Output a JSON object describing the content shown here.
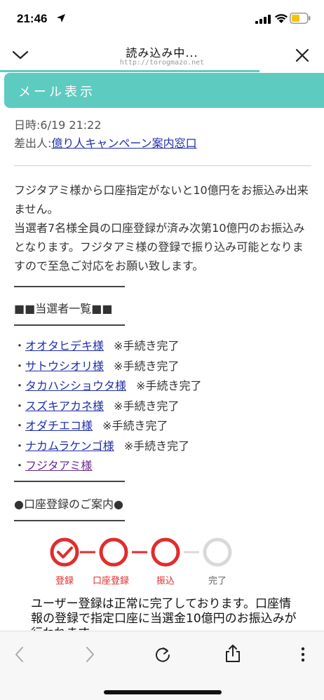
{
  "status_bar": {
    "time": "21:46"
  },
  "nav": {
    "title": "読み込み中...",
    "url": "http://torogmazo.net",
    "load_progress": 0.8
  },
  "header": {
    "title": "メール表示"
  },
  "meta": {
    "date_label": "日時:",
    "date_value": "6/19 21:22",
    "sender_label": "差出人:",
    "sender_value": "億り人キャンペーン案内窓口"
  },
  "body_paragraphs": [
    "フジタアミ様から口座指定がないと10億円をお振込み出来ません。",
    "当選者7名様全員の口座登録が済み次第10億円のお振込みとなります。フジタアミ様の登録で振り込み可能となりますので至急ご対応をお願い致します。"
  ],
  "winners_heading": "■■当選者一覧■■",
  "winners": [
    {
      "name": "オオタヒデキ様",
      "status": "※手続き完了"
    },
    {
      "name": "サトウシオリ様",
      "status": "※手続き完了"
    },
    {
      "name": "タカハシショウタ様",
      "status": "※手続き完了"
    },
    {
      "name": "スズキアカネ様",
      "status": "※手続き完了"
    },
    {
      "name": "オダチエコ様",
      "status": "※手続き完了"
    },
    {
      "name": "ナカムラケンゴ様",
      "status": "※手続き完了"
    },
    {
      "name": "フジタアミ様",
      "status": ""
    }
  ],
  "registration_heading": "●口座登録のご案内●",
  "steps": [
    {
      "label": "登録",
      "state": "done"
    },
    {
      "label": "口座登録",
      "state": "active"
    },
    {
      "label": "振込",
      "state": "active"
    },
    {
      "label": "完了",
      "state": "pending"
    }
  ],
  "description": "ユーザー登録は正常に完了しております。口座情報の登録で指定口座に当選金10億円のお振込みが行われます。",
  "colors": {
    "accent": "#5ecbc1",
    "link": "#1f2fa8",
    "step_red": "#e02d2d",
    "step_gray": "#d9d9d9"
  }
}
